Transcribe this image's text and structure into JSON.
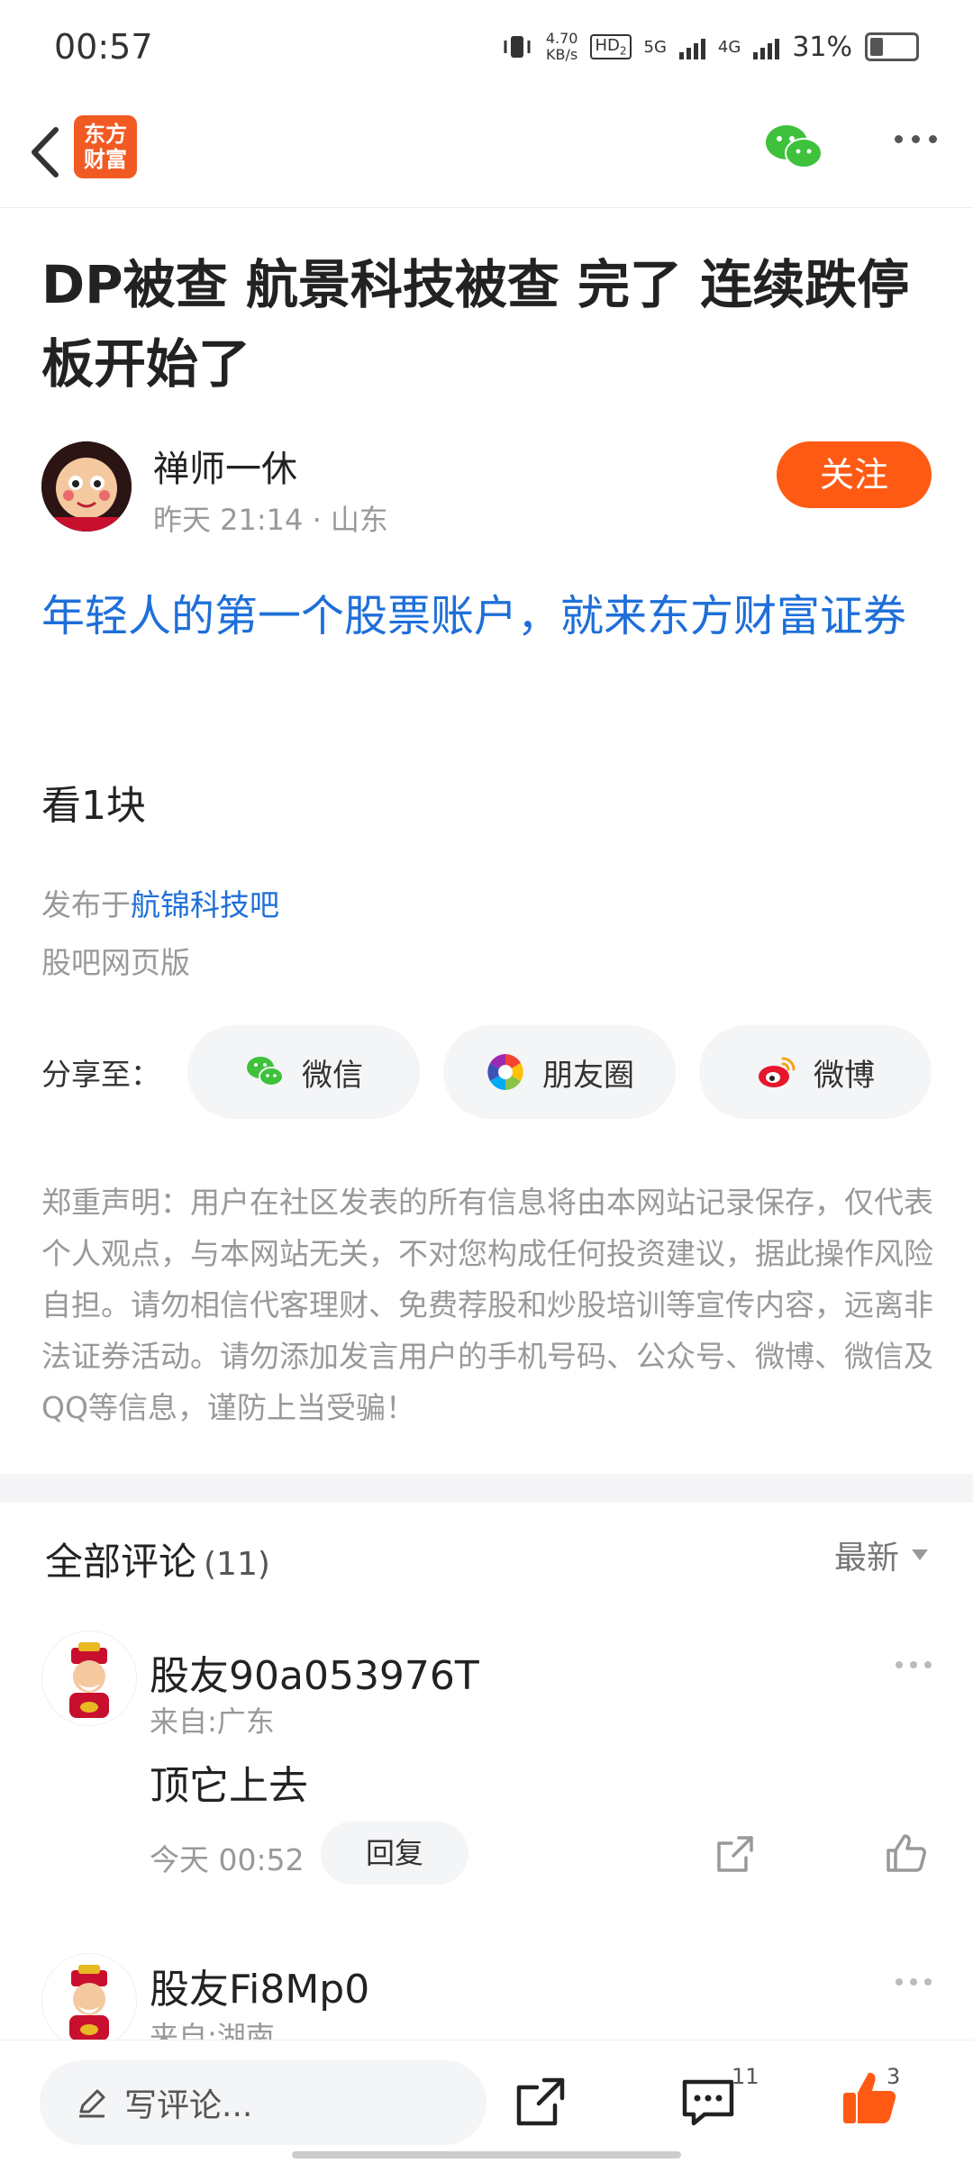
{
  "status": {
    "time": "00:57",
    "net_speed_top": "4.70",
    "net_speed_bottom": "KB/s",
    "hd": "HD",
    "hd_sub": "2",
    "sig1": "5G",
    "sig2": "4G",
    "battery": "31%"
  },
  "header": {
    "logo_line1": "东方",
    "logo_line2": "财富"
  },
  "article": {
    "title": "DP被查 航景科技被查 完了 连续跌停板开始了",
    "author_name": "禅师一休",
    "author_meta": "昨天 21:14 · 山东",
    "follow_label": "关注",
    "promo": "年轻人的第一个股票账户，就来东方财富证券",
    "body": "看1块",
    "posted_prefix": "发布于",
    "posted_bar": "航锦科技吧",
    "source": "股吧网页版"
  },
  "share": {
    "label": "分享至：",
    "buttons": [
      {
        "label": "微信",
        "icon": "wechat-icon"
      },
      {
        "label": "朋友圈",
        "icon": "moments-icon"
      },
      {
        "label": "微博",
        "icon": "weibo-icon"
      }
    ]
  },
  "disclaimer": "郑重声明：用户在社区发表的所有信息将由本网站记录保存，仅代表个人观点，与本网站无关，不对您构成任何投资建议，据此操作风险自担。请勿相信代客理财、免费荐股和炒股培训等宣传内容，远离非法证券活动。请勿添加发言用户的手机号码、公众号、微博、微信及QQ等信息，谨防上当受骗！",
  "comments": {
    "title": "全部评论",
    "count": "(11)",
    "sort_label": "最新",
    "items": [
      {
        "name": "股友90a053976T",
        "location": "来自:广东",
        "text": "顶它上去",
        "time": "今天 00:52",
        "reply_label": "回复"
      },
      {
        "name": "股友Fi8Mp0",
        "location": "来自:湖南"
      }
    ]
  },
  "bottom_bar": {
    "write_placeholder": "写评论...",
    "comment_count": "11",
    "like_count": "3"
  },
  "colors": {
    "accent": "#ff5a14",
    "link": "#1e6fd9",
    "muted": "#999999"
  }
}
